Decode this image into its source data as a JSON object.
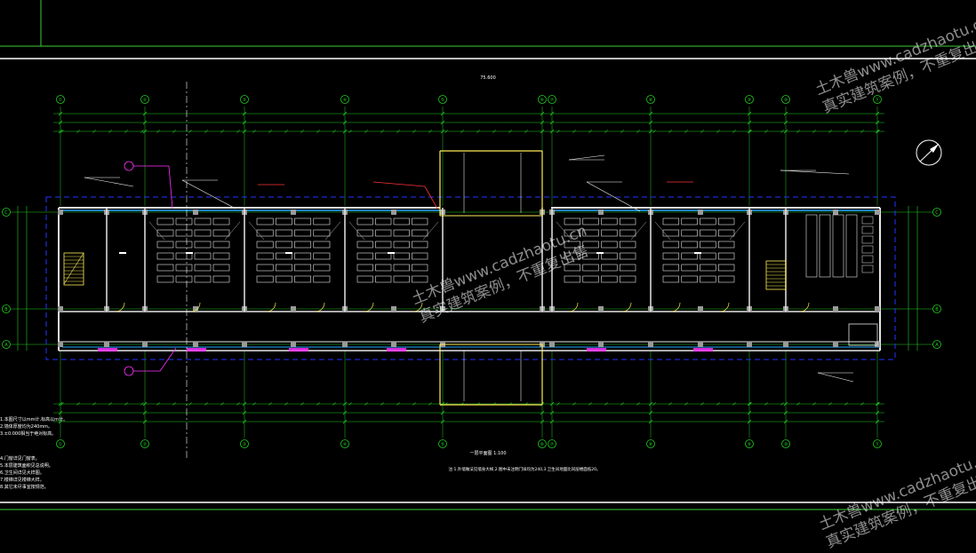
{
  "drawing": {
    "colors": {
      "background": "#000000",
      "axis": "#22cc22",
      "dim": "#22cc22",
      "wall": "#e6e6e6",
      "window": "#22aaff",
      "column": "#9a9a9a",
      "door": "#ffee55",
      "stair": "#ffee55",
      "magenta": "#ff33ff",
      "red_note": "#ff3333",
      "outline_dash": "#2233ff",
      "white": "#ffffff"
    },
    "axis_top_labels": [
      "①",
      "②",
      "③",
      "④",
      "⑤",
      "⑥",
      "⑦",
      "⑧",
      "⑨",
      "⑩",
      "⑪"
    ],
    "axis_side_labels": [
      "C",
      "B",
      "A"
    ],
    "total_length": "75.600",
    "plan_title": "一层平面图 1:100",
    "bottom_note": "注:1.外墙做法见墙身大样,2.图中未注明门垛均为240,3.卫生间地面比同层楼面低20。"
  },
  "notes_panel": {
    "lines": [
      "1.本图尺寸以mm计,标高以m计。",
      "2.墙体厚度均为240mm。",
      "3.±0.000相当于绝对标高。",
      "4.门窗详见门窗表。",
      "5.本层建筑面积见总说明。",
      "6.卫生间详见大样图。",
      "7.楼梯详见楼梯大样。",
      "8.其它未尽事宜按规范。"
    ]
  },
  "watermark": {
    "line1": "土木兽www.cadzhaotu.cn",
    "line2": "真实建筑案例，不重复出售"
  }
}
